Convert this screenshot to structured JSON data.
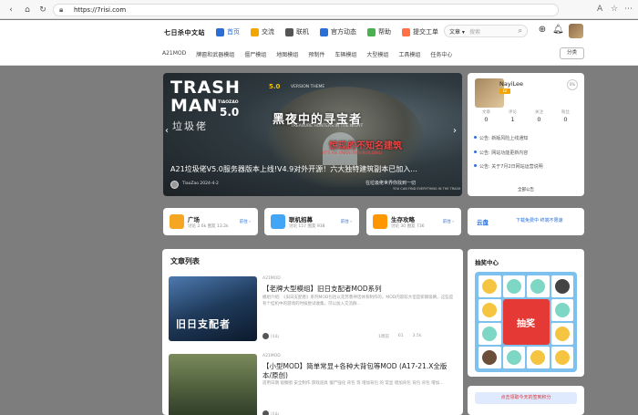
{
  "browser": {
    "url": "https://7risi.com",
    "icons": [
      "back-icon",
      "forward-icon",
      "refresh-icon",
      "home-icon",
      "lock-icon",
      "translate-icon",
      "star-icon",
      "settings-icon"
    ]
  },
  "header": {
    "logo": "七日杀中文站",
    "nav": [
      {
        "label": "首页",
        "icon": "home-icon",
        "color": "#2b6fd6"
      },
      {
        "label": "交流",
        "icon": "chat-icon",
        "color": "#f2a600"
      },
      {
        "label": "联机",
        "icon": "server-icon",
        "color": "#555555"
      },
      {
        "label": "官方动态",
        "icon": "star-icon",
        "color": "#2b6fd6"
      },
      {
        "label": "帮助",
        "icon": "help-icon",
        "color": "#4caf50"
      },
      {
        "label": "提交工单",
        "icon": "ticket-icon",
        "color": "#ff7043"
      }
    ],
    "search": {
      "select": "文章 ▾",
      "placeholder": "搜索"
    },
    "subnav": [
      "A21MOD",
      "牌匾和武器模组",
      "僵尸模组",
      "地图模组",
      "预制件",
      "车辆模组",
      "大型模组",
      "工具模组",
      "任务中心"
    ],
    "category_button": "分类"
  },
  "banner": {
    "trash": "TRASH",
    "man": "MAN",
    "tiaozao": "TIAOZAO",
    "version": "5.0",
    "lajilao": "垃圾佬",
    "badge": "5.0",
    "version_theme": "VERSION THEME",
    "seeker": "黑夜中的寻宝者",
    "treasure_hunters": "TREASURE HUNTERS IN THE NIGHT",
    "fearless": "惊现的不知名建筑",
    "unknown": "IT'S AN UNKNOWN BUILDING",
    "headline": "A21垃圾佬V5.0服务器版本上线!V4.9对外开源！六大独特建筑副本已加入...",
    "author": "TiaoZao",
    "date": "2024-4-2",
    "slogan": "在垃圾佬世界你找到一切",
    "slogan_en": "YOU CAN FIND EVERYTHING IN THE TRASH"
  },
  "profile": {
    "name": "NayiLee",
    "level": "LV",
    "percent": "0%",
    "stats": [
      {
        "label": "文章",
        "value": "0"
      },
      {
        "label": "评论",
        "value": "1"
      },
      {
        "label": "关注",
        "value": "0"
      },
      {
        "label": "粉丝",
        "value": "0"
      }
    ],
    "notices": [
      "公告: 新版风险上线通知",
      "公告: 网站功能更新内容",
      "公告: 关于7月2日网站运营说明"
    ],
    "all_notices": "全部公告"
  },
  "quick": [
    {
      "title": "广场",
      "stats": "讨论 2.6k  围友 13.2k",
      "more": "前往 ›",
      "color": "#f5a623"
    },
    {
      "title": "联机招募",
      "stats": "讨论 157  围友 938",
      "more": "前往 ›",
      "color": "#42a5f5"
    },
    {
      "title": "生存攻略",
      "stats": "讨论 30  围友 736",
      "more": "前往 ›",
      "color": "#ff9800"
    }
  ],
  "cloud": {
    "logo": "云盘",
    "text": "下载免费中 终端不限速"
  },
  "articles": {
    "heading": "文章列表",
    "items": [
      {
        "category": "A21MOD",
        "title": "【老牌大型模组】旧日支配者MOD系列",
        "excerpt": "模组介绍: 《旧日支配者》系列MOD包括以克苏鲁神话体系制作的，MOD内容较大但是新颖吸睛。这些是有个挂机中的游戏的时候尝试收集，可以加入交流群...",
        "author": "川山",
        "stats": [
          "1周前",
          "61",
          "3.5k"
        ],
        "thumb_text": "旧日支配者",
        "thumb_color": "#1f3a5a"
      },
      {
        "category": "A21MOD",
        "title": "【小型MOD】简单常显+各种大背包等MOD (A17-21.X全版本/原创)",
        "excerpt": "适用日期 观察图 安全制作 游戏道具 僵尸强化 背包 等 增加背包 的 常显 增加背包 背包 背包 增加...",
        "author": "川山",
        "stats": [
          "",
          "",
          ""
        ],
        "thumb_text": "",
        "thumb_color": "#5a6a4a"
      }
    ]
  },
  "lottery": {
    "heading": "抽奖中心",
    "draw_label": "抽奖"
  },
  "bottom_banner": "点击领取今天的签到积分"
}
